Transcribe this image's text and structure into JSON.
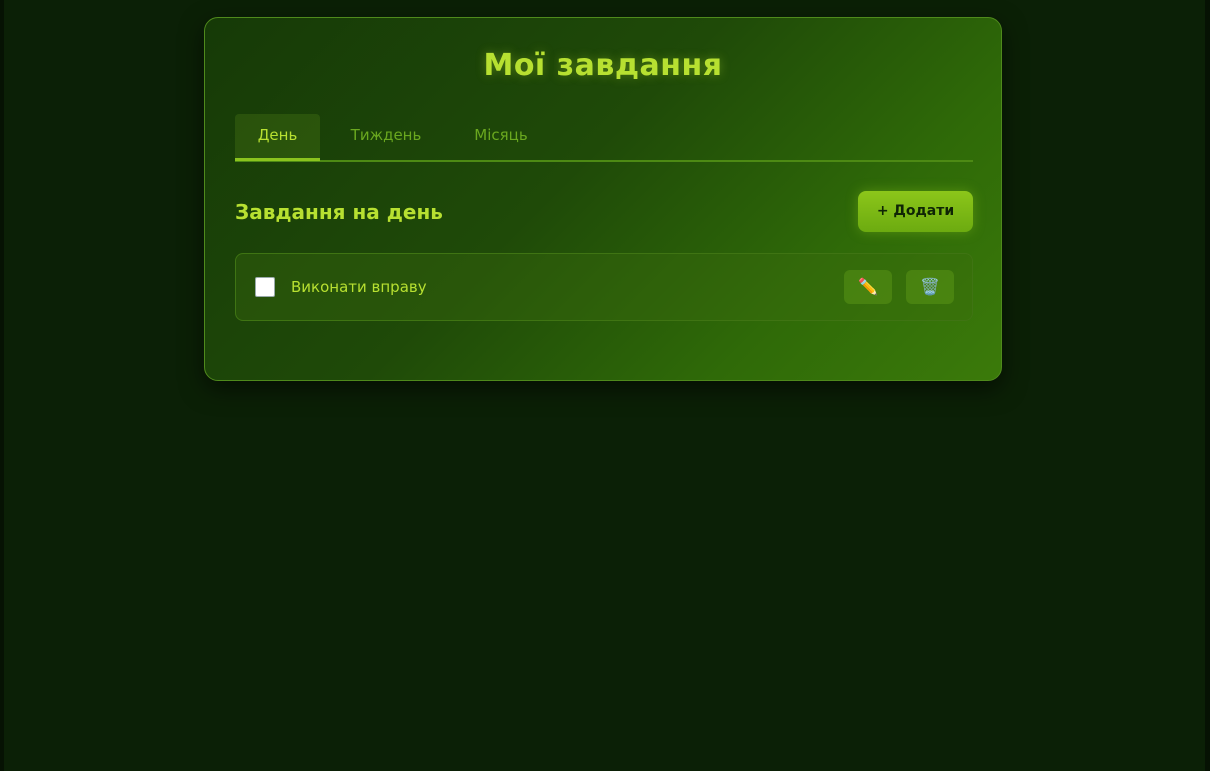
{
  "app": {
    "title": "Мої завдання"
  },
  "tabs": [
    {
      "label": "День",
      "active": true
    },
    {
      "label": "Тиждень",
      "active": false
    },
    {
      "label": "Місяць",
      "active": false
    }
  ],
  "section": {
    "title": "Завдання на день",
    "add_label": "+ Додати"
  },
  "tasks": [
    {
      "label": "Виконати вправу",
      "done": false,
      "edit_icon": "✏️",
      "delete_icon": "🗑️"
    }
  ],
  "colors": {
    "accent": "#b7e031",
    "button": "#8cc61a",
    "background": "#0b2006"
  }
}
